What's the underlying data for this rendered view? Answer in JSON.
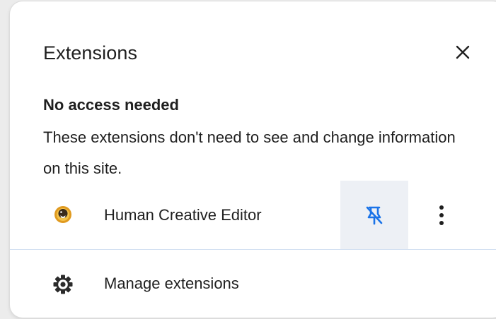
{
  "popup": {
    "title": "Extensions",
    "close_icon": "close-icon"
  },
  "no_access": {
    "heading": "No access needed",
    "description": "These extensions don't need to see and change information on this site."
  },
  "extensions": [
    {
      "name": "Human Creative Editor",
      "icon": "extension-logo-icon",
      "pinned": true,
      "pin_icon": "unpin-icon",
      "menu_icon": "more-vertical-icon"
    }
  ],
  "manage": {
    "label": "Manage extensions",
    "icon": "gear-icon"
  },
  "colors": {
    "accent": "#1a73e8",
    "text": "#1f1f1f",
    "pin_bg": "#edf0f5",
    "divider": "#d3e0f2"
  }
}
